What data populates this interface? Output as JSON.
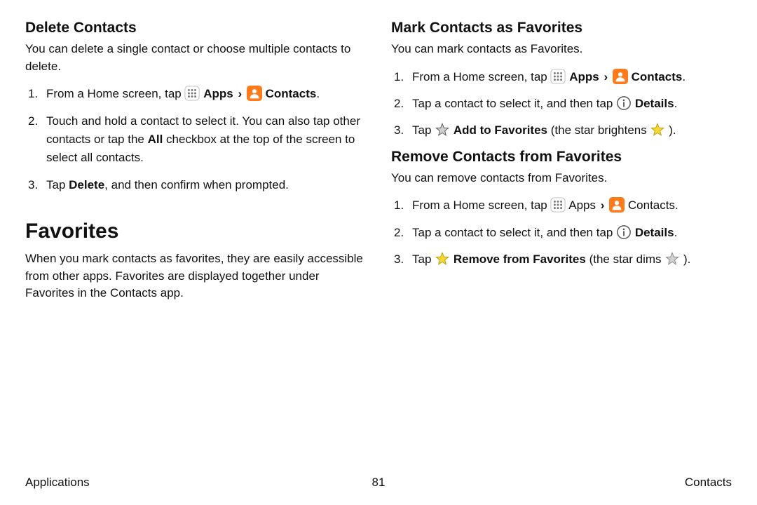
{
  "left": {
    "h_delete": "Delete Contacts",
    "p_delete": "You can delete a single contact or choose multiple contacts to delete.",
    "s1_prefix": "From a Home screen, tap ",
    "s1_apps": "Apps",
    "s1_contacts": "Contacts",
    "s2_a": "Touch and hold a contact to select it. You can also tap other contacts or tap the ",
    "s2_all": "All",
    "s2_b": " checkbox at the top of the screen to select all contacts.",
    "s3_a": "Tap ",
    "s3_del": "Delete",
    "s3_b": ", and then confirm when prompted.",
    "h_fav": "Favorites",
    "p_fav": "When you mark contacts as favorites, they are easily accessible from other apps. Favorites are displayed together under Favorites in the Contacts app."
  },
  "right": {
    "h_mark": "Mark Contacts as Favorites",
    "p_mark": "You can mark contacts as Favorites.",
    "m1_prefix": "From a Home screen, tap ",
    "m1_apps": "Apps",
    "m1_contacts": "Contacts",
    "m2_a": "Tap a contact to select it, and then tap ",
    "m2_details": "Details",
    "m3_a": "Tap ",
    "m3_add": "Add to Favorites",
    "m3_b": " (the star brightens ",
    "m3_c": ").",
    "h_remove": "Remove Contacts from Favorites",
    "p_remove": "You can remove contacts from Favorites.",
    "r1_prefix": "From a Home screen, tap ",
    "r1_apps": "Apps",
    "r1_contacts": "Contacts",
    "r2_a": "Tap a contact to select it, and then tap ",
    "r2_details": "Details",
    "r3_a": "Tap ",
    "r3_remove": "Remove from Favorites",
    "r3_b": " (the star dims ",
    "r3_c": ")."
  },
  "footer": {
    "left": "Applications",
    "center": "81",
    "right": "Contacts"
  },
  "glyphs": {
    "chevron": "›"
  }
}
